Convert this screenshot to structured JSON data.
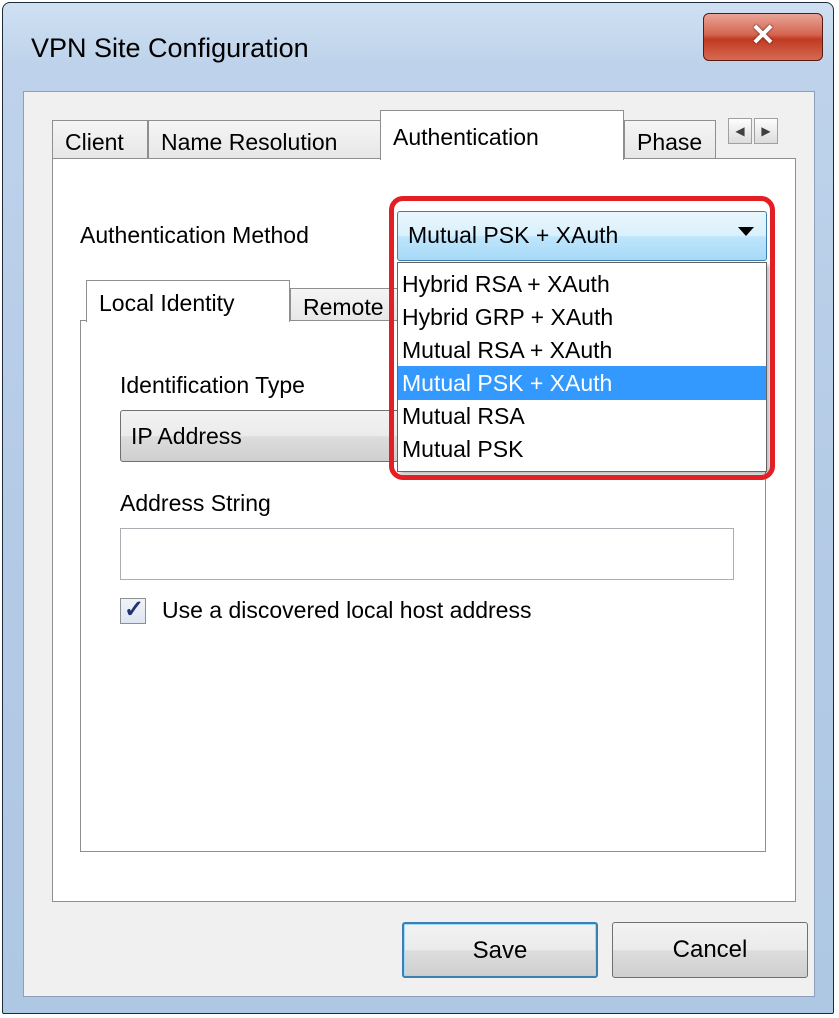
{
  "window": {
    "title": "VPN Site Configuration",
    "close_glyph": "✕"
  },
  "tabs": [
    {
      "label": "Client"
    },
    {
      "label": "Name Resolution"
    },
    {
      "label": "Authentication"
    },
    {
      "label": "Phase"
    }
  ],
  "auth": {
    "label": "Authentication Method",
    "selected": "Mutual PSK + XAuth",
    "options": [
      "Hybrid RSA + XAuth",
      "Hybrid GRP + XAuth",
      "Mutual RSA + XAuth",
      "Mutual PSK + XAuth",
      "Mutual RSA",
      "Mutual PSK"
    ],
    "selected_index": 3
  },
  "inner_tabs": [
    {
      "label": "Local Identity"
    },
    {
      "label": "Remote"
    }
  ],
  "identification": {
    "label": "Identification Type",
    "value": "IP Address"
  },
  "address": {
    "label": "Address String",
    "value": ""
  },
  "checkbox": {
    "label": "Use a discovered local host address",
    "checked": true
  },
  "buttons": {
    "save": "Save",
    "cancel": "Cancel"
  },
  "colors": {
    "highlight": "#e31e24",
    "selection": "#3399ff"
  },
  "icons": {
    "close": "close-icon",
    "caret": "chevron-down-icon",
    "left": "arrow-left-icon",
    "right": "arrow-right-icon",
    "check": "check-icon"
  }
}
